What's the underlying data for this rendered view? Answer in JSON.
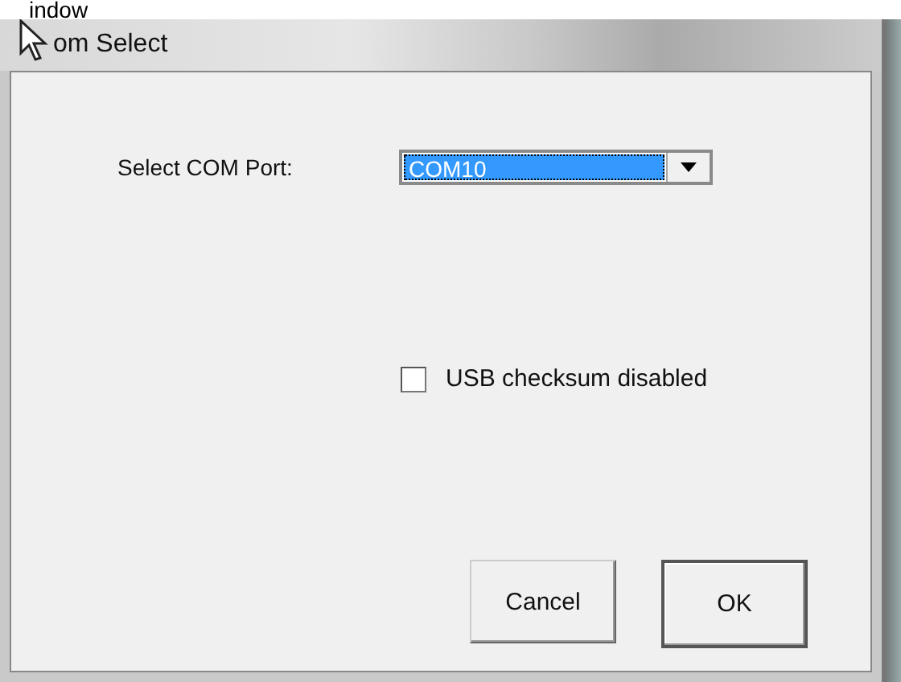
{
  "background_text": "indow",
  "window": {
    "title": "om Select"
  },
  "port": {
    "label": "Select COM Port:",
    "value": "COM10"
  },
  "checkbox": {
    "label": "USB checksum disabled",
    "checked": false
  },
  "buttons": [
    {
      "label": "Cancel",
      "default": false
    },
    {
      "label": "OK",
      "default": true
    }
  ]
}
